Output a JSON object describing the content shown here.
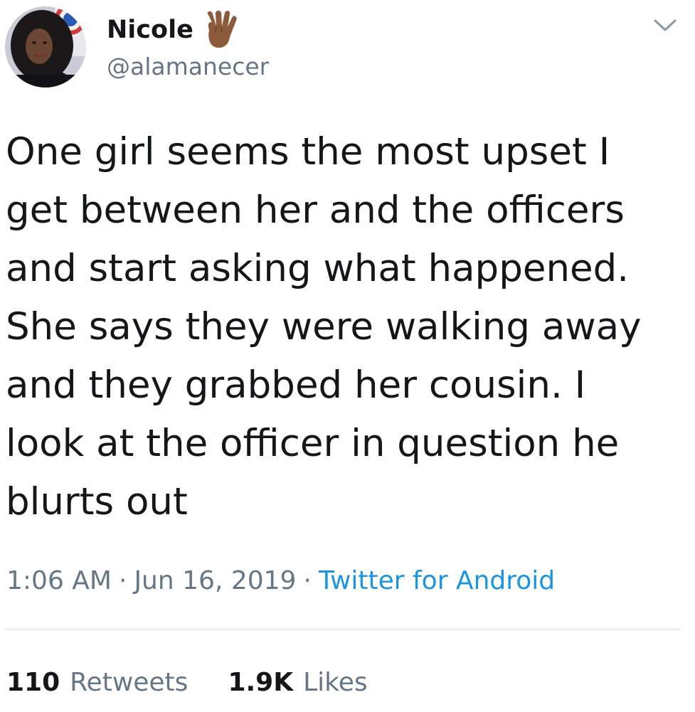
{
  "user": {
    "display_name": "Nicole",
    "name_emoji": "vulcan-salute-emoji",
    "handle": "@alamanecer",
    "avatar": "profile-photo"
  },
  "more_menu_icon": "chevron-down-icon",
  "tweet": {
    "text": "One girl seems the most upset I\nget between her and the officers\nand start asking what happened.\nShe says they were walking away\nand they grabbed her cousin. I\nlook at the officer in question he\nblurts out",
    "time": "1:06 AM",
    "separator": "·",
    "date": "Jun 16, 2019",
    "source": "Twitter for Android"
  },
  "stats": {
    "retweets_count": "110",
    "retweets_label": "Retweets",
    "likes_count": "1.9K",
    "likes_label": "Likes"
  },
  "colors": {
    "text": "#14171a",
    "secondary": "#657786",
    "link": "#1b95e0",
    "divider": "#e6ecf0"
  }
}
